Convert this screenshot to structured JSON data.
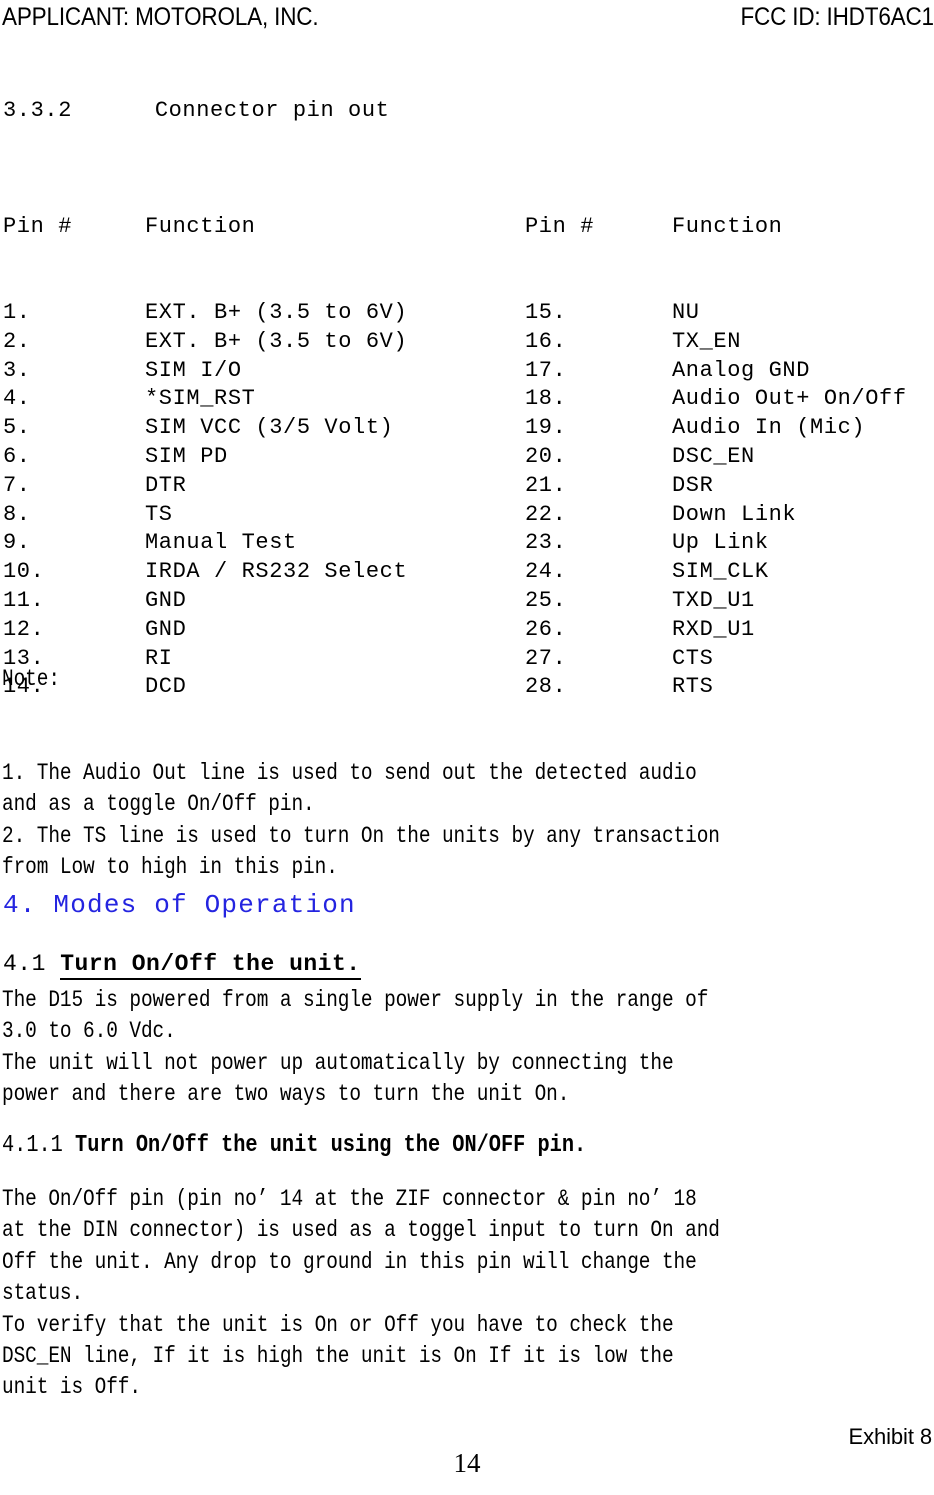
{
  "header": {
    "applicant": "APPLICANT:  MOTOROLA, INC.",
    "fcc_id": "FCC ID: IHDT6AC1"
  },
  "section_332": {
    "number": "3.3.2",
    "title": "Connector pin out",
    "line": "3.3.2      Connector pin out"
  },
  "pin_table": {
    "headers": {
      "left_pin": "Pin #",
      "left_function": "Function",
      "right_pin": "Pin #",
      "right_function": "Function"
    },
    "rows": [
      {
        "lnum": "1.",
        "lfn": "EXT. B+ (3.5 to 6V)",
        "rnum": "15.",
        "rfn": "NU"
      },
      {
        "lnum": "2.",
        "lfn": "EXT. B+ (3.5 to 6V)",
        "rnum": "16.",
        "rfn": "TX_EN"
      },
      {
        "lnum": "3.",
        "lfn": "SIM I/O",
        "rnum": "17.",
        "rfn": "Analog GND"
      },
      {
        "lnum": "4.",
        "lfn": "*SIM_RST",
        "rnum": "18.",
        "rfn": "Audio Out+ On/Off"
      },
      {
        "lnum": "5.",
        "lfn": "SIM VCC (3/5 Volt)",
        "rnum": "19.",
        "rfn": "Audio In (Mic)"
      },
      {
        "lnum": "6.",
        "lfn": "SIM PD",
        "rnum": "20.",
        "rfn": "DSC_EN"
      },
      {
        "lnum": "7.",
        "lfn": "DTR",
        "rnum": "21.",
        "rfn": "DSR"
      },
      {
        "lnum": "8.",
        "lfn": "TS",
        "rnum": "22.",
        "rfn": "Down Link"
      },
      {
        "lnum": "9.",
        "lfn": "Manual Test",
        "rnum": "23.",
        "rfn": "Up Link"
      },
      {
        "lnum": "10.",
        "lfn": "IRDA / RS232 Select",
        "rnum": "24.",
        "rfn": "SIM_CLK"
      },
      {
        "lnum": "11.",
        "lfn": "GND",
        "rnum": "25.",
        "rfn": "TXD_U1"
      },
      {
        "lnum": "12.",
        "lfn": "GND",
        "rnum": "26.",
        "rfn": "RXD_U1"
      },
      {
        "lnum": "13.",
        "lfn": "RI",
        "rnum": "27.",
        "rfn": "CTS"
      },
      {
        "lnum": "14.",
        "lfn": "DCD",
        "rnum": "28.",
        "rfn": "RTS"
      }
    ]
  },
  "notes": {
    "label": "Note:",
    "lines": [
      "1. The Audio Out line is used to send out the detected audio",
      "and as a toggle On/Off pin.",
      "2. The TS line is used to turn On the units by any transaction",
      "from Low to high in this pin."
    ]
  },
  "chapter_4": {
    "heading": "4. Modes of Operation",
    "color": "#2424e0"
  },
  "section_41": {
    "number": "4.1",
    "title": "Turn On/Off the unit.",
    "paragraph_lines": [
      "The D15 is powered from a single power supply in the range of",
      "3.0 to 6.0 Vdc.",
      "The unit will not power up automatically by connecting the",
      "power and there are two ways to turn the unit On."
    ]
  },
  "section_411": {
    "number": "4.1.1",
    "title": "Turn On/Off the unit using the ON/OFF pin.",
    "paragraph_lines": [
      "The On/Off pin (pin no’ 14 at the ZIF connector & pin no’ 18",
      "at the DIN connector) is used as a toggel input to turn On and",
      "Off the unit. Any drop to ground in this pin will change the",
      "status.",
      "To verify that the unit is On or Off you have to check the",
      "DSC_EN line, If it is high the unit is On If it is low the",
      "unit is Off."
    ]
  },
  "footer": {
    "page_number": "14",
    "exhibit": "Exhibit 8"
  }
}
